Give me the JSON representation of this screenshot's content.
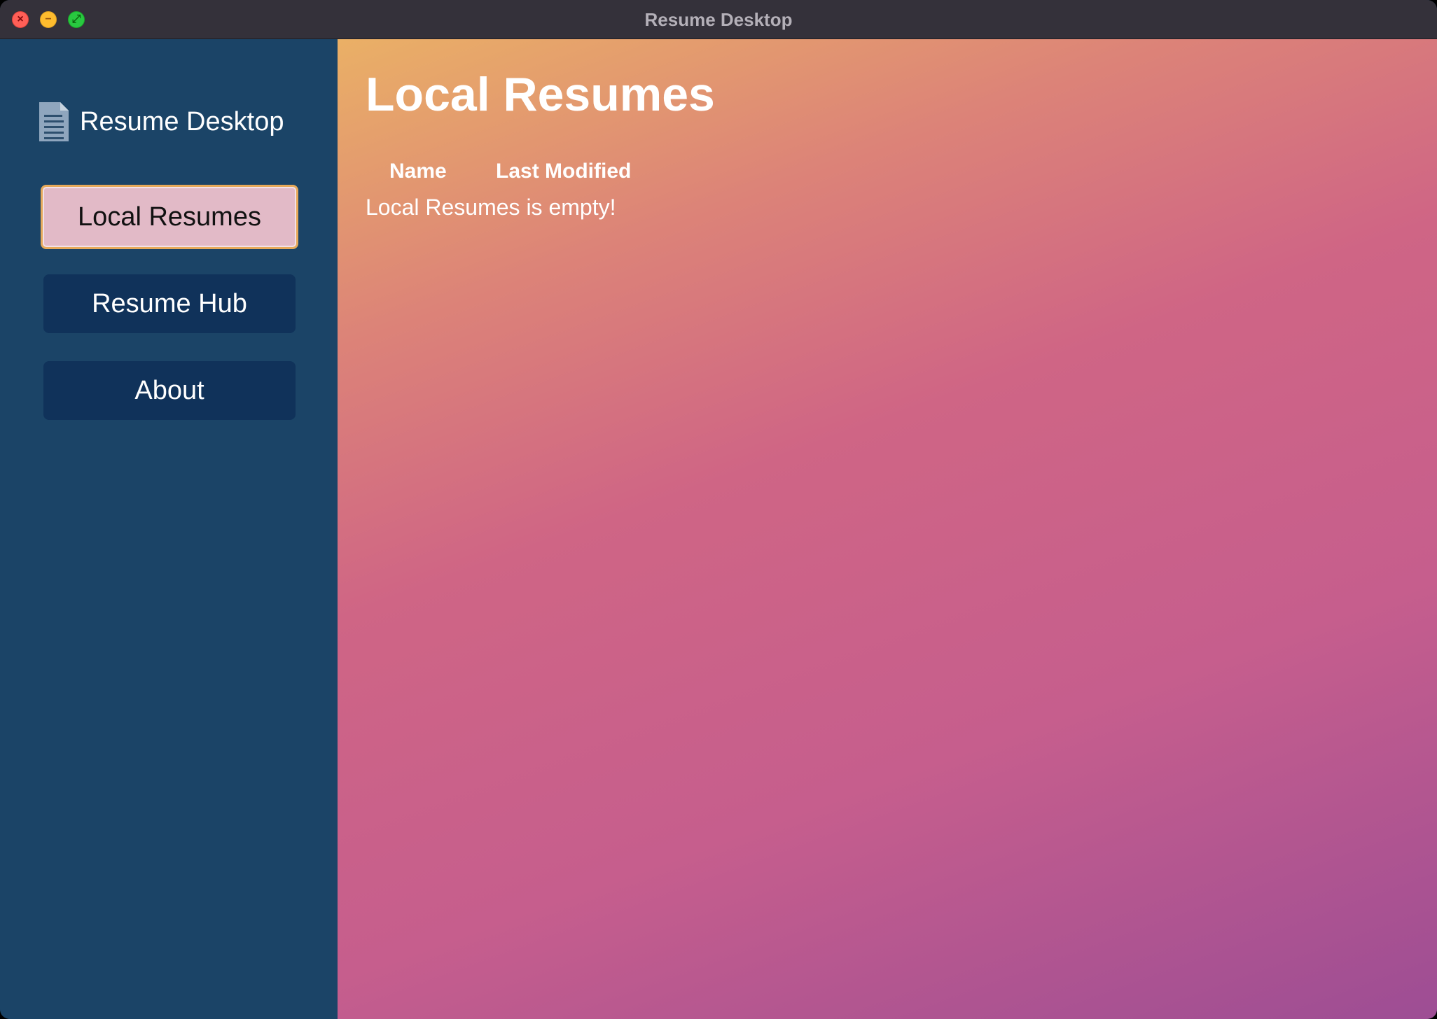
{
  "window": {
    "title": "Resume Desktop"
  },
  "sidebar": {
    "brand_label": "Resume Desktop",
    "brand_icon": "document-icon",
    "items": [
      {
        "label": "Local Resumes",
        "active": true
      },
      {
        "label": "Resume Hub",
        "active": false
      },
      {
        "label": "About",
        "active": false
      }
    ]
  },
  "main": {
    "title": "Local Resumes",
    "columns": [
      "Name",
      "Last Modified"
    ],
    "rows": [],
    "empty_message": "Local Resumes is empty!"
  },
  "colors": {
    "sidebar_bg": "#1b4467",
    "nav_button_bg": "#10325a",
    "active_button_bg": "#e2bac7",
    "active_button_border": "#e6a95a"
  }
}
